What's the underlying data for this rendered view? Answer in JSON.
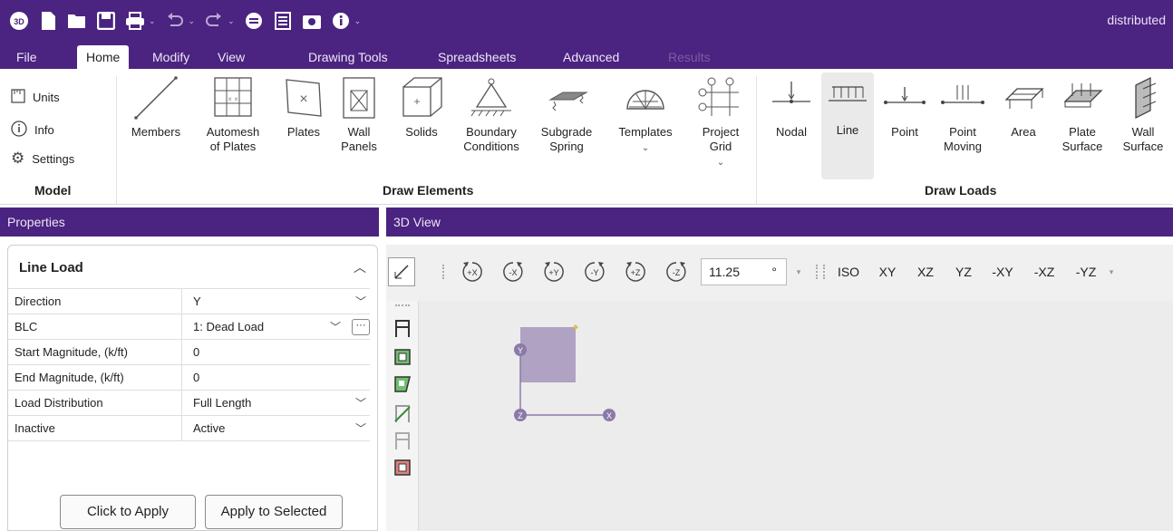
{
  "window": {
    "title": "distributed"
  },
  "qat": {
    "items": [
      "app-logo-icon",
      "new-file-icon",
      "open-folder-icon",
      "save-icon",
      "print-icon",
      "undo-icon",
      "redo-icon",
      "minus-circle-icon",
      "document-icon",
      "camera-icon",
      "info-icon"
    ]
  },
  "menu": {
    "tabs": [
      {
        "label": "File"
      },
      {
        "label": "Home"
      },
      {
        "label": "Modify"
      },
      {
        "label": "View"
      },
      {
        "label": "Drawing Tools"
      },
      {
        "label": "Spreadsheets"
      },
      {
        "label": "Advanced"
      },
      {
        "label": "Results"
      }
    ],
    "active": "Home"
  },
  "ribbon": {
    "model": {
      "units": "Units",
      "info": "Info",
      "settings": "Settings",
      "group_label": "Model"
    },
    "draw_elements": {
      "group_label": "Draw Elements",
      "members": "Members",
      "automesh_1": "Automesh",
      "automesh_2": "of Plates",
      "plates": "Plates",
      "wall_1": "Wall",
      "wall_2": "Panels",
      "solids": "Solids",
      "boundary_1": "Boundary",
      "boundary_2": "Conditions",
      "subgrade_1": "Subgrade",
      "subgrade_2": "Spring",
      "templates": "Templates",
      "grid_1": "Project",
      "grid_2": "Grid"
    },
    "draw_loads": {
      "group_label": "Draw Loads",
      "nodal": "Nodal",
      "line": "Line",
      "point": "Point",
      "point_moving_1": "Point",
      "point_moving_2": "Moving",
      "area": "Area",
      "plate_surface_1": "Plate",
      "plate_surface_2": "Surface",
      "wall_surface_1": "Wall",
      "wall_surface_2": "Surface"
    }
  },
  "properties": {
    "header": "Properties",
    "section_title": "Line Load",
    "rows": [
      {
        "label": "Direction",
        "value": "Y"
      },
      {
        "label": "BLC",
        "value": "1: Dead Load"
      },
      {
        "label": "Start Magnitude, (k/ft)",
        "value": "0"
      },
      {
        "label": "End Magnitude, (k/ft)",
        "value": "0"
      },
      {
        "label": "Load Distribution",
        "value": "Full Length"
      },
      {
        "label": "Inactive",
        "value": "Active"
      }
    ],
    "buttons": {
      "apply": "Click to Apply",
      "apply_selected": "Apply to Selected"
    }
  },
  "view3d": {
    "header": "3D View",
    "rotate_buttons": [
      "+X",
      "-X",
      "+Y",
      "-Y",
      "+Z",
      "-Z"
    ],
    "angle": "11.25",
    "angle_unit": "°",
    "view_buttons": [
      "ISO",
      "XY",
      "XZ",
      "YZ",
      "-XY",
      "-XZ",
      "-YZ"
    ],
    "axes": {
      "x": "X",
      "y": "Y",
      "z": "Z"
    }
  },
  "colors": {
    "brand": "#4b2380",
    "ribbon_bg": "#ffffff",
    "axis_node": "#8b7aa8",
    "plane_fill": "#9b8ab5"
  }
}
